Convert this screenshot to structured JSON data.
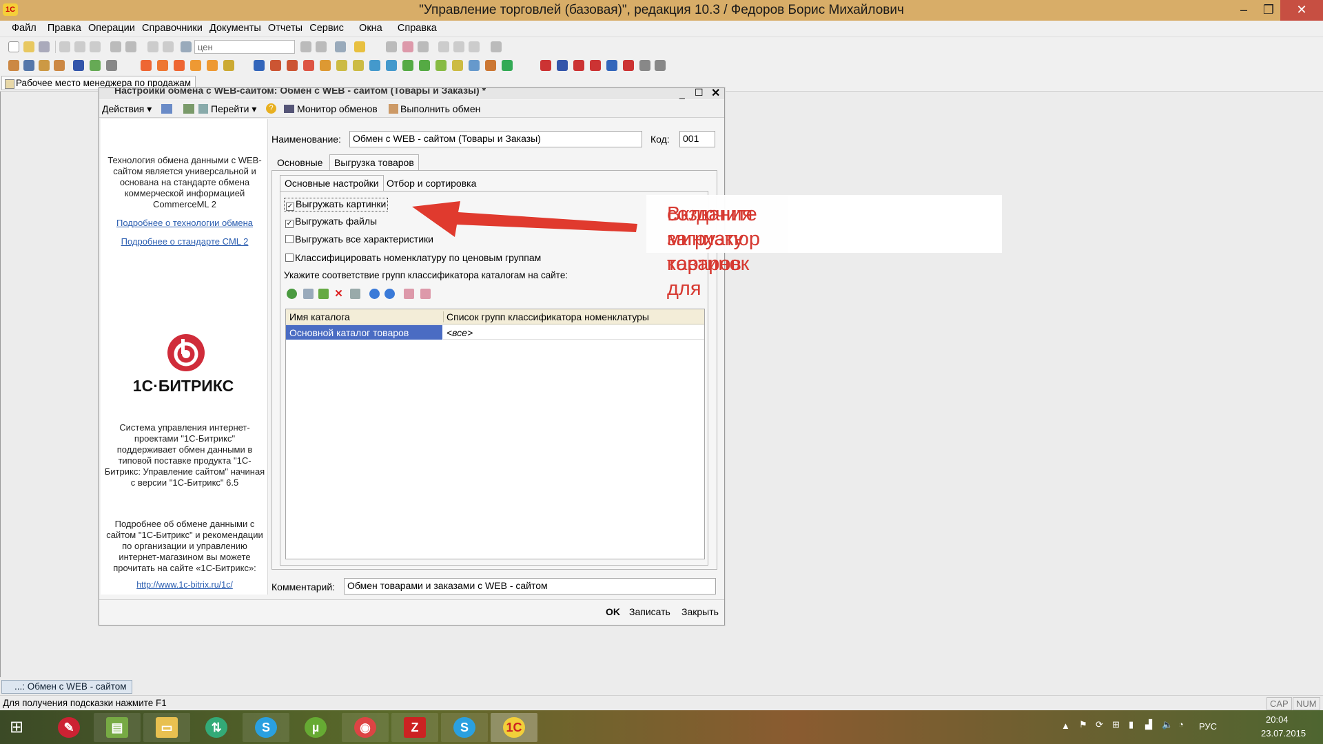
{
  "titlebar": {
    "title": "\"Управление торговлей (базовая)\", редакция 10.3 / Федоров Борис Михайлович",
    "logo": "1С"
  },
  "menu": [
    "Файл",
    "Правка",
    "Операции",
    "Справочники",
    "Документы",
    "Отчеты",
    "Сервис",
    "Окна",
    "Справка"
  ],
  "toolbar": {
    "search_value": "цен"
  },
  "panel": {
    "tab_label": "Рабочее место менеджера по продажам"
  },
  "window": {
    "title": "Настройки обмена с WEB-сайтом: Обмен с WEB - сайтом (Товары и Заказы) *",
    "actions": {
      "actions": "Действия",
      "go": "Перейти",
      "monitor": "Монитор обменов",
      "run": "Выполнить обмен"
    },
    "left": {
      "intro": "Технология обмена данными с WEB-сайтом является универсальной и основана на стандарте обмена коммерческой информацией CommerceML 2",
      "link_tech": "Подробнее о технологии обмена",
      "link_cml": "Подробнее о стандарте CML 2",
      "brand": "1С·БИТРИКС",
      "system": "Система управления интернет-проектами \"1С-Битрикс\" поддерживает обмен данными в типовой поставке продукта \"1С-Битрикс: Управление сайтом\" начиная с версии \"1С-Битрикс\" 6.5",
      "more": "Подробнее об обмене данными с сайтом \"1С-Битрикс\" и рекомендации по организации и управлению интернет-магазином вы можете прочитать на сайте «1С-Битрикс»:",
      "url": "http://www.1c-bitrix.ru/1c/"
    },
    "form": {
      "name_label": "Наименование:",
      "name_value": "Обмен с WEB - сайтом (Товары и Заказы)",
      "code_label": "Код:",
      "code_value": "001",
      "tabs": [
        "Основные",
        "Выгрузка товаров"
      ],
      "subtabs": [
        "Основные настройки",
        "Отбор и сортировка"
      ],
      "checks": [
        {
          "label": "Выгружать картинки",
          "checked": true
        },
        {
          "label": "Выгружать файлы",
          "checked": true
        },
        {
          "label": "Выгружать все характеристики",
          "checked": false
        },
        {
          "label": "Классифицировать номенклатуру по ценовым группам",
          "checked": false
        }
      ],
      "groups_caption": "Укажите соответствие групп классификатора каталогам на сайте:",
      "grid": {
        "columns": [
          "Имя каталога",
          "Список групп классификатора номенклатуры"
        ],
        "rows": [
          [
            "Основной каталог товаров",
            "<все>"
          ]
        ]
      },
      "comment_label": "Комментарий:",
      "comment_value": "Обмен товарами и заказами с WEB - сайтом"
    },
    "buttons": {
      "ok": "OK",
      "save": "Записать",
      "close": "Закрыть"
    }
  },
  "callout": {
    "line1": "Включите загрузку картинок для",
    "line2": "создания миниатюр товаров",
    "color": "#d6322a"
  },
  "win_taskbar": {
    "item": "...: Обмен с WEB - сайтом ..."
  },
  "status": {
    "hint": "Для получения подсказки нажмите F1",
    "cap": "CAP",
    "num": "NUM"
  },
  "tray": {
    "lang": "РУС",
    "time": "20:04",
    "date": "23.07.2015"
  }
}
